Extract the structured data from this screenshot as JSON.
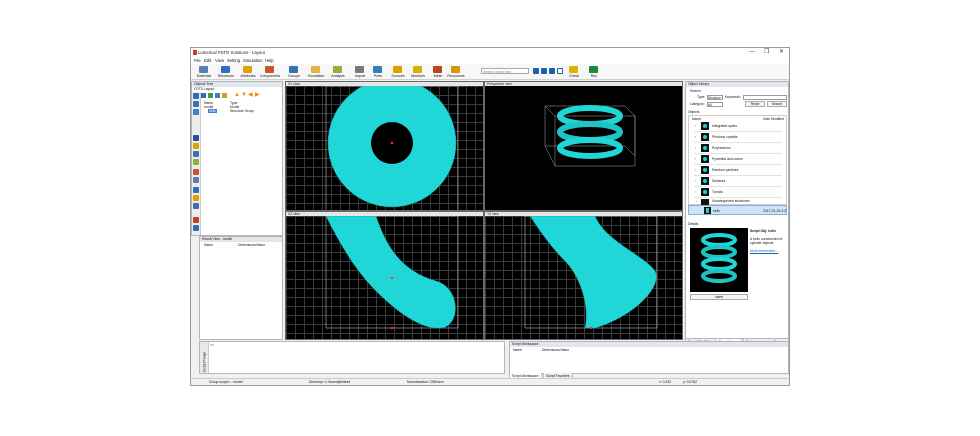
{
  "window": {
    "title": "Lumerical FDTD Solutions - Layout",
    "controls": [
      "—",
      "❐",
      "✕"
    ]
  },
  "menu": [
    "File",
    "Edit",
    "View",
    "Setting",
    "Simulation",
    "Help"
  ],
  "toolbar": {
    "buttons": [
      {
        "label": "Materials",
        "color": "#5a7fb5"
      },
      {
        "label": "Structures",
        "color": "#2c6fbf"
      },
      {
        "label": "Attributes",
        "color": "#e0a100"
      },
      {
        "label": "Components",
        "color": "#c9552a"
      },
      {
        "label": "Groups",
        "color": "#3a6fb0"
      },
      {
        "label": "Simulation",
        "color": "#e8b04a"
      },
      {
        "label": "Analysis",
        "color": "#8fb03a"
      },
      {
        "label": "Import",
        "color": "#7a7a7a"
      },
      {
        "label": "Ports",
        "color": "#2f7dc2"
      },
      {
        "label": "Sources",
        "color": "#e0a000"
      },
      {
        "label": "Monitors",
        "color": "#d4b000"
      },
      {
        "label": "Mesh",
        "color": "#c04020"
      },
      {
        "label": "Resources",
        "color": "#d49a00"
      },
      {
        "label": "Check",
        "color": "#e0b000"
      },
      {
        "label": "Run",
        "color": "#1d8a3a"
      }
    ],
    "search_placeholder": "Search online help"
  },
  "objects_tree": {
    "title": "Objects Tree",
    "subtitle": "FDTD Layout",
    "col_name": "Name",
    "col_type": "Type",
    "rows": [
      {
        "name": "model",
        "type": "Model"
      },
      {
        "name": "helix",
        "type": "Structure Group"
      }
    ]
  },
  "result_view": {
    "title": "Result View - model",
    "col_name": "Name",
    "col_value": "Dimensions/Value"
  },
  "views": {
    "xy": "XY view",
    "perspective": "Perspective view",
    "xz": "XZ view",
    "yz": "YZ view"
  },
  "object_library": {
    "title": "Object Library",
    "search_label": "Search",
    "type_label": "Type:",
    "type_value": "Structure",
    "keywords_label": "Keywords:",
    "category_label": "Category:",
    "category_value": "All",
    "reset_label": "Reset",
    "search_button": "Search",
    "objects_label": "Objects",
    "col_name": "Name",
    "col_date": "Date Modified",
    "items": [
      {
        "name": "Integrated optics"
      },
      {
        "name": "Photonic crystals"
      },
      {
        "name": "Polyhedrons"
      },
      {
        "name": "Pyramids and cones"
      },
      {
        "name": "Random particles"
      },
      {
        "name": "Surfaces"
      },
      {
        "name": "Toroids"
      },
      {
        "name": "Uncategorized structures"
      }
    ],
    "selected_item": {
      "name": "helix",
      "date": "2017-01-24 4:3"
    },
    "details_label": "Details",
    "details_title": "Script Obj: helix",
    "details_desc": "A helix constructed of cylinder objects.",
    "details_link": "More information...",
    "insert_label": "Insert",
    "tabs": [
      "Script File Editor",
      "Object Library",
      "Optimizations and Sweeps"
    ]
  },
  "script_prompt": {
    "side_label": "Script Prompt",
    "prompt": ">>"
  },
  "script_workspace": {
    "title": "Script Workspace",
    "col_name": "Name",
    "col_value": "Dimensions/Value",
    "tabs": [
      "Script Workspace",
      "Script Favorites"
    ]
  },
  "status": {
    "group_scope": "Group scope= ::model",
    "directory": "Directory: C:/Users/jfeldes4",
    "normalization": "Normalization: CWNorm",
    "x": "x: 0.232",
    "y": "y: 0.0762"
  },
  "colors": {
    "accent": "#1a5fb4",
    "shape": "#20d6d6",
    "view_bg": "#000000"
  }
}
